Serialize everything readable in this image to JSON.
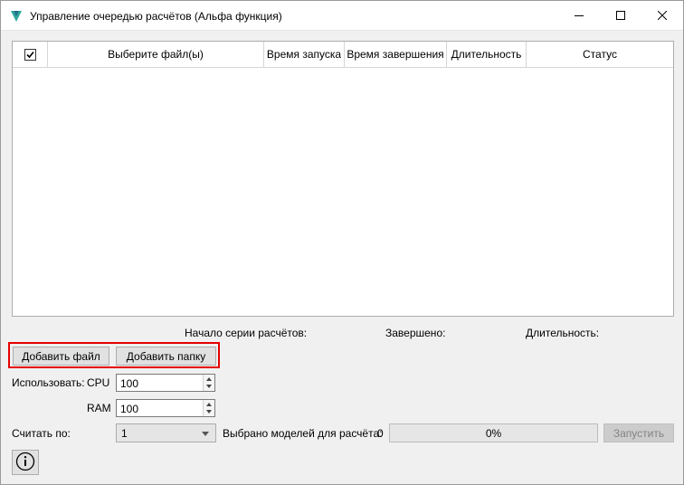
{
  "window": {
    "title": "Управление очередью расчётов (Альфа функция)",
    "icon": "app-logo-icon"
  },
  "table": {
    "select_all_checked": true,
    "columns": [
      "Выберите файл(ы)",
      "Время запуска",
      "Время завершения",
      "Длительность",
      "Статус"
    ],
    "rows": []
  },
  "summary": {
    "series_start_label": "Начало серии расчётов:",
    "finished_label": "Завершено:",
    "duration_label": "Длительность:"
  },
  "actions": {
    "add_file": "Добавить файл",
    "add_folder": "Добавить папку",
    "run": "Запустить"
  },
  "resources": {
    "use_label": "Использовать:",
    "cpu_label": "CPU",
    "cpu_value": "100",
    "ram_label": "RAM",
    "ram_value": "100"
  },
  "calc": {
    "count_by_label": "Считать по:",
    "count_by_value": "1",
    "selected_models_label": "Выбрано моделей для расчёта:",
    "selected_models_count": "0",
    "progress_percent": 0,
    "progress_text": "0%"
  },
  "colors": {
    "highlight": "#e60000",
    "logo_primary": "#2aa89a",
    "logo_secondary": "#1f6f8b"
  }
}
